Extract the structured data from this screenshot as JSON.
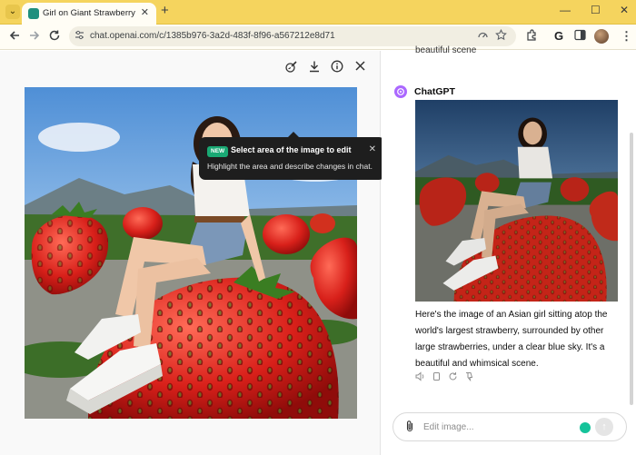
{
  "browser": {
    "tab_title": "Girl on Giant Strawberry",
    "tab_close": "✕",
    "new_tab": "+",
    "tab_menu": "⌄",
    "url": "chat.openai.com/c/1385b976-3a2d-483f-8f96-a567212e8d71",
    "icons": {
      "back": "arrow-left-icon",
      "forward": "arrow-right-icon",
      "reload": "reload-icon",
      "site_info": "tune-icon",
      "performance": "gauge-icon",
      "bookmark": "star-icon",
      "extensions": "puzzle-icon",
      "grammarly": "g-icon",
      "side_panel": "side-panel-icon",
      "menu": "kebab-menu-icon"
    },
    "window_controls": {
      "minimize": "—",
      "maximize": "☐",
      "close": "✕"
    }
  },
  "editor": {
    "tools": {
      "select_area": "brush-icon",
      "download": "download-icon",
      "info": "info-icon",
      "close": "close-icon"
    },
    "tooltip": {
      "badge": "NEW",
      "title": "Select area of the image to edit",
      "description": "Highlight the area and describe changes in chat.",
      "close": "✕"
    }
  },
  "chat": {
    "previous_text_fragment": "beautiful scene",
    "assistant_name": "ChatGPT",
    "response": "Here's the image of an Asian girl sitting atop the world's largest strawberry, surrounded by other large strawberries, under a clear blue sky. It's a beautiful and whimsical scene.",
    "actions": [
      "speaker-icon",
      "copy-icon",
      "regenerate-icon",
      "thumbs-down-icon"
    ],
    "input": {
      "placeholder": "Edit image...",
      "value": ""
    },
    "send_icon": "↑"
  },
  "colors": {
    "titlebar": "#f5d45e",
    "tooltip_badge": "#19a974",
    "assistant_avatar": "#ab68ff"
  }
}
